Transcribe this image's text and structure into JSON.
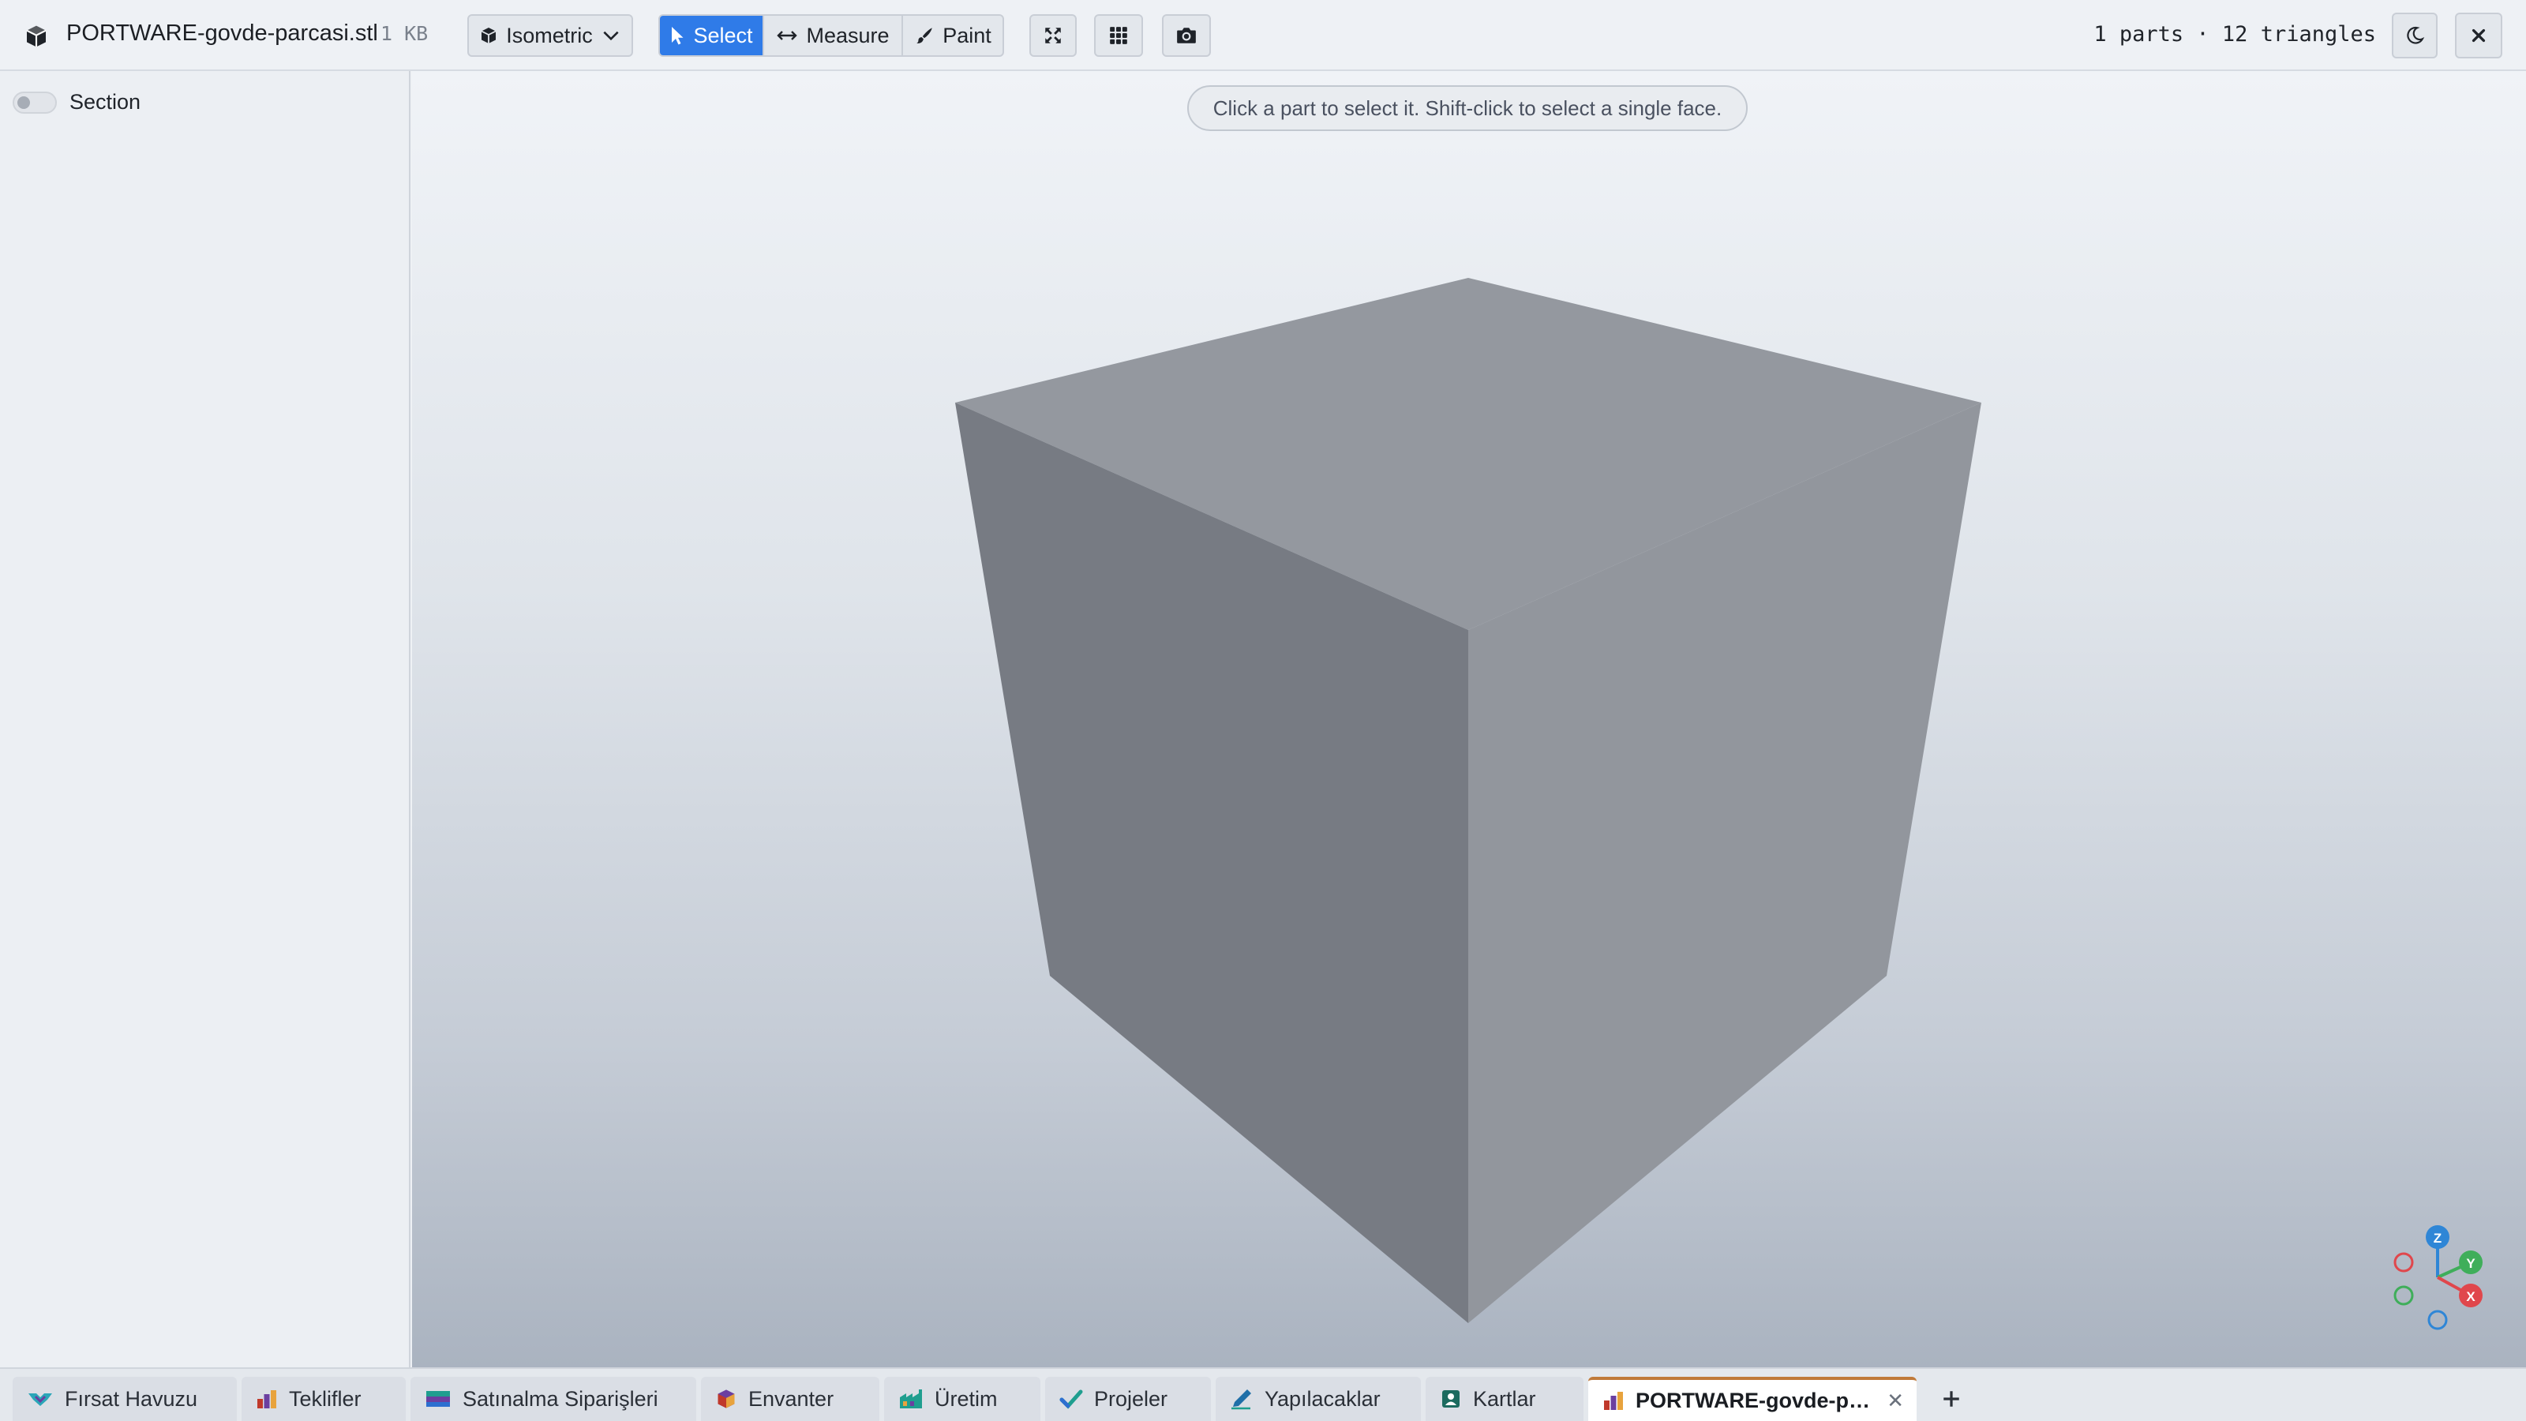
{
  "toolbar": {
    "file_name": "PORTWARE-govde-parcasi.stl",
    "file_size": "1 KB",
    "view_dropdown_label": "Isometric",
    "modes": {
      "select": "Select",
      "measure": "Measure",
      "paint": "Paint"
    },
    "active_mode": "select",
    "stats": "1 parts · 12 triangles",
    "accent_color": "#2f7be8"
  },
  "sidebar": {
    "section_toggle": {
      "label": "Section",
      "checked": false
    }
  },
  "viewport": {
    "hint": "Click a part to select it. Shift-click to select a single face.",
    "part_color": "#8e939a",
    "gizmo_axes": {
      "z": "Z",
      "y": "Y",
      "x": "X"
    },
    "gizmo_colors": {
      "z": "#2f86d6",
      "y": "#3fae5a",
      "x": "#e0474c"
    }
  },
  "tabs": [
    {
      "label": "Fırsat Havuzu",
      "icon": "handshake-icon"
    },
    {
      "label": "Teklifler",
      "icon": "bar-chart-icon"
    },
    {
      "label": "Satınalma Siparişleri",
      "icon": "card-icon"
    },
    {
      "label": "Envanter",
      "icon": "box-icon"
    },
    {
      "label": "Üretim",
      "icon": "factory-icon"
    },
    {
      "label": "Projeler",
      "icon": "check-icon"
    },
    {
      "label": "Yapılacaklar",
      "icon": "pen-icon"
    },
    {
      "label": "Kartlar",
      "icon": "id-card-icon"
    },
    {
      "label": "PORTWARE-govde-p…",
      "icon": "bar-chart-icon",
      "active": true
    }
  ],
  "active_tab_accent": "#c07a3a"
}
